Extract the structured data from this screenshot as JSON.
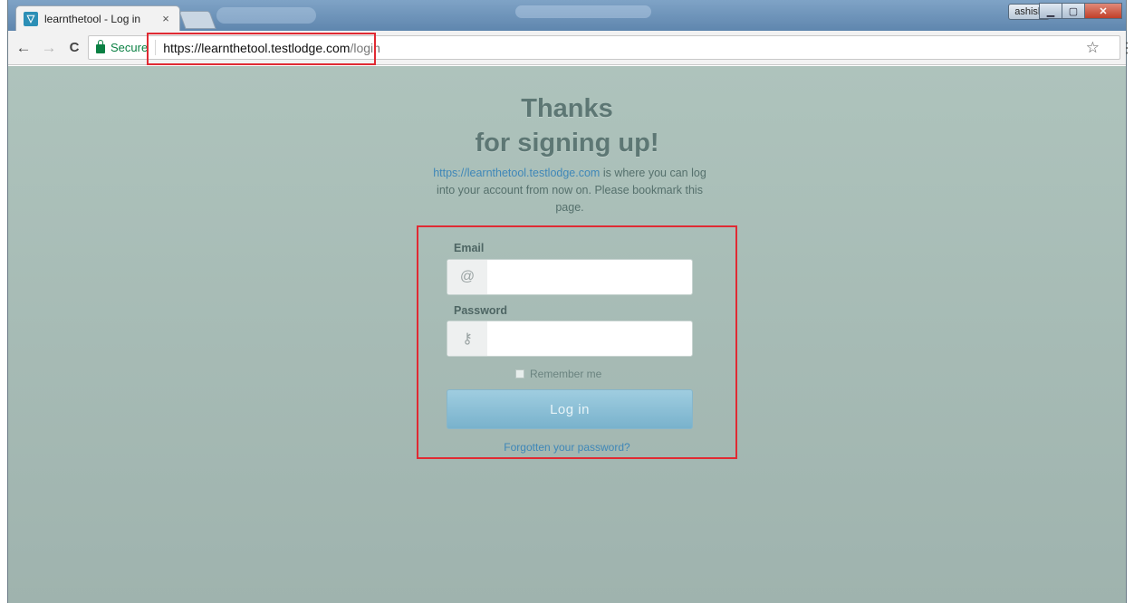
{
  "browser": {
    "tab_title": "learnthetool - Log in",
    "tab_close": "×",
    "user_badge": "ashish",
    "window_controls": {
      "minimize": "▁",
      "maximize": "▢",
      "close": "✕"
    },
    "nav": {
      "back": "←",
      "forward": "→",
      "reload": "C"
    },
    "secure_label": "Secure",
    "url_host": "https://learnthetool.testlodge.com",
    "url_path": "/login",
    "bookmark_icon": "☆",
    "menu_icon": "⋮"
  },
  "page": {
    "headline_line1": "Thanks",
    "headline_line2": "for signing up!",
    "intro_link": "https://learnthetool.testlodge.com",
    "intro_text": " is where you can log into your account from now on. Please bookmark this page.",
    "form": {
      "email_label": "Email",
      "email_icon": "@",
      "email_value": "",
      "password_label": "Password",
      "password_icon": "⚷",
      "password_value": "",
      "remember_label": "Remember me",
      "login_button": "Log in",
      "forgot_link": "Forgotten your password?"
    }
  },
  "colors": {
    "page_background": "#a8bdb7",
    "headline": "#5d7774",
    "link": "#3f87b8",
    "button": "#8cc1d7",
    "highlight_box": "#e02a33"
  }
}
